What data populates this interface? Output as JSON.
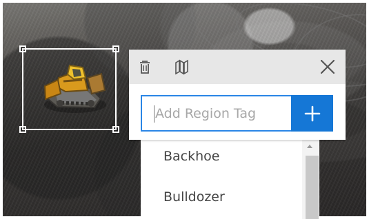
{
  "canvas": {
    "background": "construction site aerial image",
    "region_box": {
      "label": "",
      "object_icon": "bulldozer-icon"
    }
  },
  "tag_panel": {
    "toolbar": {
      "delete_icon": "trash-icon",
      "layers_icon": "layers-icon",
      "close_icon": "close-icon"
    },
    "input": {
      "placeholder": "Add Region Tag",
      "value": ""
    },
    "add_button": {
      "label": "+",
      "icon": "plus-icon",
      "color": "#1577d6"
    },
    "suggestions": [
      {
        "label": "Backhoe"
      },
      {
        "label": "Bulldozer"
      }
    ]
  },
  "colors": {
    "input_border": "#2a86e6",
    "toolbar_background": "#e7e7e7",
    "text": "#444444"
  }
}
